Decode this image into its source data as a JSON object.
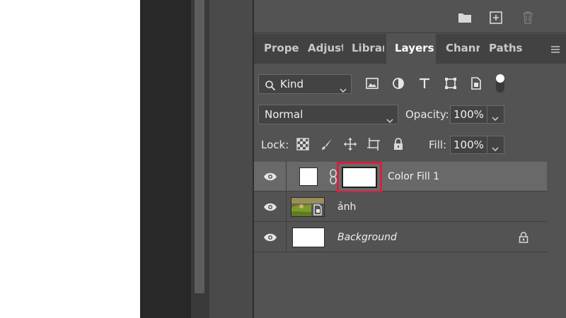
{
  "colors": {
    "panel_bg": "#535353",
    "selected_layer": "#696969",
    "highlight": "#d4213d"
  },
  "top_icons": [
    "folder-icon",
    "new-layer-icon",
    "trash-icon"
  ],
  "tabs": [
    {
      "label": "Proper",
      "active": false
    },
    {
      "label": "Adjust",
      "active": false
    },
    {
      "label": "Librari",
      "active": false
    },
    {
      "label": "Layers",
      "active": true
    },
    {
      "label": "Channe",
      "active": false
    },
    {
      "label": "Paths",
      "active": false
    }
  ],
  "filter": {
    "kind_label": "Kind",
    "icons": [
      "image-filter-icon",
      "adjustment-filter-icon",
      "type-filter-icon",
      "shape-filter-icon",
      "smart-object-filter-icon",
      "filter-toggle-icon"
    ]
  },
  "blend": {
    "mode": "Normal",
    "opacity_label": "Opacity:",
    "opacity_value": "100%"
  },
  "lock": {
    "label": "Lock:",
    "icons": [
      "lock-transparent-icon",
      "lock-brush-icon",
      "lock-position-icon",
      "lock-artboard-icon",
      "lock-all-icon"
    ],
    "fill_label": "Fill:",
    "fill_value": "100%"
  },
  "layers": [
    {
      "name": "Color Fill 1",
      "selected": true,
      "italic": false
    },
    {
      "name": "ảnh",
      "selected": false,
      "italic": false
    },
    {
      "name": "Background",
      "selected": false,
      "italic": true,
      "locked": true
    }
  ]
}
